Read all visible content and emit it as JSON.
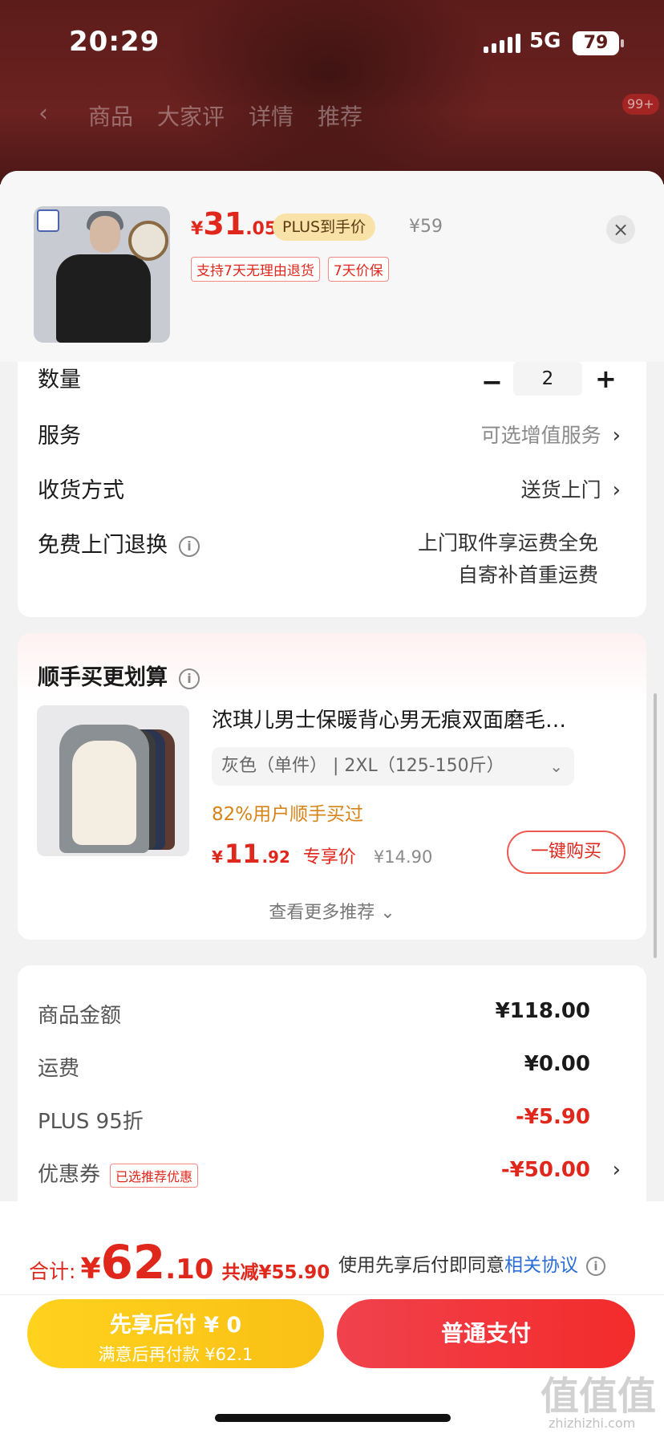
{
  "status_bar": {
    "time": "20:29",
    "network": "5G",
    "battery": "79"
  },
  "nav": {
    "tabs": [
      "商品",
      "大家评",
      "详情",
      "推荐"
    ],
    "badge": "99+"
  },
  "product": {
    "price_symbol": "¥",
    "price_int": "31",
    "price_dec": ".05",
    "plus_label": "PLUS到手价",
    "original_price": "¥59",
    "tags": [
      "支持7天无理由退货",
      "7天价保"
    ]
  },
  "options": {
    "quantity_label": "数量",
    "quantity_value": "2",
    "service_label": "服务",
    "service_value": "可选增值服务",
    "delivery_label": "收货方式",
    "delivery_value": "送货上门",
    "return_label": "免费上门退换",
    "return_value_line1": "上门取件享运费全免",
    "return_value_line2": "自寄补首重运费"
  },
  "recommend": {
    "title": "顺手买更划算",
    "item_name": "浓琪儿男士保暖背心男无痕双面磨毛…",
    "item_spec": "灰色（单件）  |  2XL（125-150斤）",
    "rate": "82%用户顺手买过",
    "price_symbol": "¥",
    "price_int": "11",
    "price_dec": ".92",
    "price_label": "专享价",
    "original_price": "¥14.90",
    "buy_label": "一键购买",
    "more_label": "查看更多推荐"
  },
  "summary": {
    "rows": [
      {
        "label": "商品金额",
        "value": "¥118.00"
      },
      {
        "label": "运费",
        "value": "¥0.00"
      },
      {
        "label": "PLUS 95折",
        "value": "-¥5.90"
      },
      {
        "label": "优惠券",
        "tag": "已选推荐优惠",
        "value": "-¥50.00"
      }
    ]
  },
  "footer": {
    "total_label": "合计:",
    "total_symbol": "¥",
    "total_int": "62",
    "total_dec": ".10",
    "saved": "共减¥55.90",
    "agree_text": "使用先享后付即同意",
    "agree_link": "相关协议",
    "pay_later_line1": "先享后付 ¥ 0",
    "pay_later_line2": "满意后再付款 ¥62.1",
    "pay_normal": "普通支付"
  },
  "watermark": {
    "logo": "值值值",
    "url": "zhizhizhi.com"
  },
  "colors": {
    "accent": "#e0271c",
    "pay_later": "#f9c015",
    "link": "#2b6dd6"
  }
}
